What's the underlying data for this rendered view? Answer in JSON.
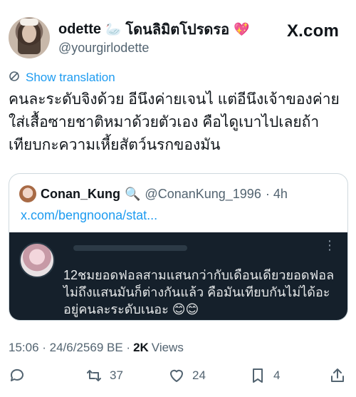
{
  "header": {
    "display_name": "odette",
    "name_emoji_1": "🦢",
    "name_thai": "โดนลิมิตโปรดรอ",
    "name_emoji_2": "💖",
    "handle": "@yourgirlodette",
    "brand": "X.com"
  },
  "translate": {
    "label": "Show translation",
    "icon": "translate-icon"
  },
  "tweet": {
    "text": "คนละระดับจิงด้วย อีนึงค่ายเจนไ แต่อีนึงเจ้าของค่าย\nใส่เสื้อซายชาติหมาด้วยตัวเอง คือไดูเบาไปเลยถ้า\nเทียบกะความเหี้ยสัตว์นรกของมัน"
  },
  "quote": {
    "name": "Conan_Kung",
    "name_emoji": "🔍",
    "handle": "@ConanKung_1996",
    "time": "· 4h",
    "link": "x.com/bengnoona/stat...",
    "embed_text": "12ชมยอดฟอลสามแสนกว่ากับเดือนเดียวยอดฟอล\nไม่ถึงแสนมันก็ต่างกันแล้ว คือมันเทียบกันไม่ได้อะ\nอยู่คนละระดับเนอะ 😊😊"
  },
  "meta": {
    "timestamp": "15:06 · 24/6/2569 BE ·",
    "views_count": "2K",
    "views_label": "Views"
  },
  "actions": {
    "reply_count": "",
    "retweet_count": "37",
    "like_count": "24",
    "bookmark_count": "4"
  },
  "colors": {
    "accent": "#1d9bf0",
    "muted": "#536471",
    "embed_bg": "#15202b"
  }
}
